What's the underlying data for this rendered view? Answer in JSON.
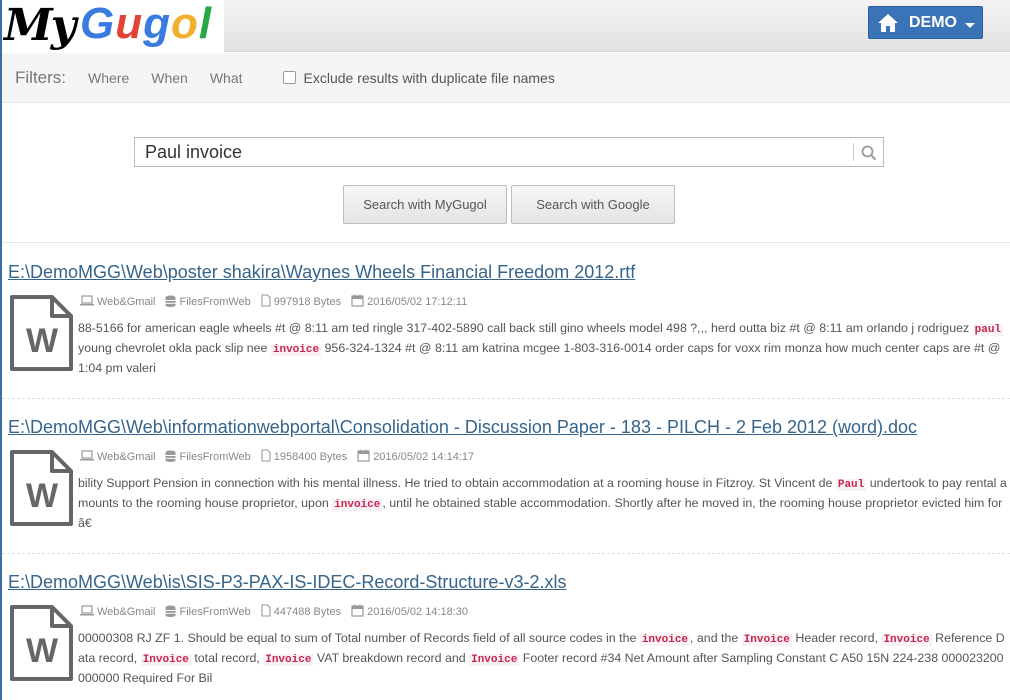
{
  "app": {
    "logo_my": "My",
    "logo_g1": "G",
    "logo_u": "u",
    "logo_g2": "g",
    "logo_o": "o",
    "logo_l": "l",
    "user_label": "DEMO"
  },
  "filters": {
    "label": "Filters:",
    "items": [
      "Where",
      "When",
      "What"
    ],
    "exclude_label": "Exclude results with duplicate file names"
  },
  "search": {
    "value": "Paul invoice",
    "btn_mygugol": "Search with MyGugol",
    "btn_google": "Search with Google"
  },
  "results": [
    {
      "title": "E:\\DemoMGG\\Web\\poster shakira\\Waynes Wheels Financial Freedom 2012.rtf",
      "source": "Web&Gmail",
      "db": "FilesFromWeb",
      "size": "997918 Bytes",
      "date": "2016/05/02 17:12:11",
      "snippet": [
        {
          "t": "88-5166 for american eagle wheels #t @ 8:11 am ted ringle 317-402-5890 call back still gino wheels model 498 ?,,, herd outta biz #t @ 8:11 am orlando j rodriguez "
        },
        {
          "h": "paul"
        },
        {
          "t": " young chevrolet okla pack slip nee "
        },
        {
          "h": "invoice"
        },
        {
          "t": " 956-324-1324 #t @ 8:11 am katrina mcgee 1-803-316-0014 order caps for voxx rim monza how much center caps are #t @ 1:04 pm valeri"
        }
      ]
    },
    {
      "title": "E:\\DemoMGG\\Web\\informationwebportal\\Consolidation - Discussion Paper - 183 - PILCH - 2 Feb 2012 (word).doc",
      "source": "Web&Gmail",
      "db": "FilesFromWeb",
      "size": "1958400 Bytes",
      "date": "2016/05/02 14:14:17",
      "snippet": [
        {
          "t": "bility Support Pension in connection with his mental illness. He tried to obtain accommodation at a rooming house in Fitzroy. St Vincent de "
        },
        {
          "h": "Paul"
        },
        {
          "t": " undertook to pay rental amounts to the rooming house proprietor, upon "
        },
        {
          "h": "invoice"
        },
        {
          "t": ", until he obtained stable accommodation. Shortly after he moved in, the rooming house proprietor evicted him for â€"
        }
      ]
    },
    {
      "title": "E:\\DemoMGG\\Web\\is\\SIS-P3-PAX-IS-IDEC-Record-Structure-v3-2.xls",
      "source": "Web&Gmail",
      "db": "FilesFromWeb",
      "size": "447488 Bytes",
      "date": "2016/05/02 14:18:30",
      "snippet": [
        {
          "t": "00000308 RJ ZF 1. Should be equal to sum of Total number of Records field of all source codes in the "
        },
        {
          "h": "invoice"
        },
        {
          "t": ", and the "
        },
        {
          "h": "Invoice"
        },
        {
          "t": " Header record, "
        },
        {
          "h": "Invoice"
        },
        {
          "t": " Reference Data record, "
        },
        {
          "h": "Invoice"
        },
        {
          "t": " total record, "
        },
        {
          "h": "Invoice"
        },
        {
          "t": " VAT breakdown record and "
        },
        {
          "h": "Invoice"
        },
        {
          "t": " Footer record #34 Net Amount after Sampling Constant C A50 15N 224-238 000023200000000 Required For Bil"
        }
      ]
    }
  ],
  "icons": {
    "home": "home-icon",
    "search": "search-icon",
    "doc": "word-document-icon",
    "laptop": "laptop-icon",
    "database": "database-icon",
    "file": "file-icon",
    "calendar": "calendar-icon"
  },
  "colors": {
    "user_button": "#3a73b7",
    "link": "#36648b",
    "highlight": "#c7254e"
  }
}
